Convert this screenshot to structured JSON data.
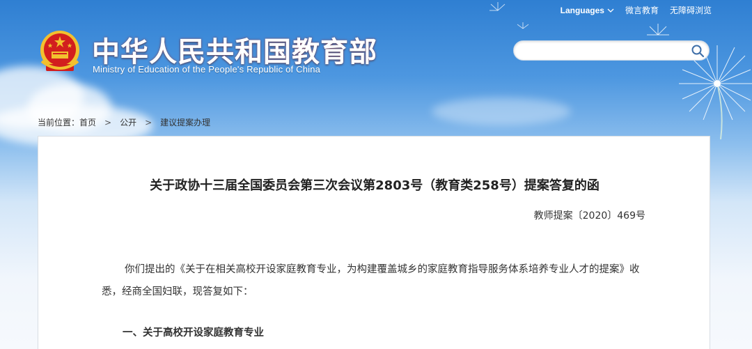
{
  "header": {
    "languages_label": "Languages",
    "weibo_label": "微言教育",
    "accessibility_label": "无障碍浏览",
    "site_title_cn": "中华人民共和国教育部",
    "site_title_en": "Ministry of Education of the People's Republic of China"
  },
  "search": {
    "placeholder": "",
    "value": ""
  },
  "breadcrumb": {
    "prefix": "当前位置：",
    "items": [
      "首页",
      "公开",
      "建议提案办理"
    ]
  },
  "article": {
    "title": "关于政协十三届全国委员会第三次会议第2803号（教育类258号）提案答复的函",
    "doc_number": "教师提案〔2020〕469号",
    "paragraph1": "你们提出的《关于在相关高校开设家庭教育专业，为构建覆盖城乡的家庭教育指导服务体系培养专业人才的提案》收悉，经商全国妇联，现答复如下：",
    "section1_heading": "一、关于高校开设家庭教育专业"
  },
  "colors": {
    "banner_top": "#2f7fd2",
    "banner_bottom": "#f6f9fd",
    "text": "#333333",
    "emblem_red": "#d21e1e",
    "emblem_gold": "#f2c02e"
  }
}
